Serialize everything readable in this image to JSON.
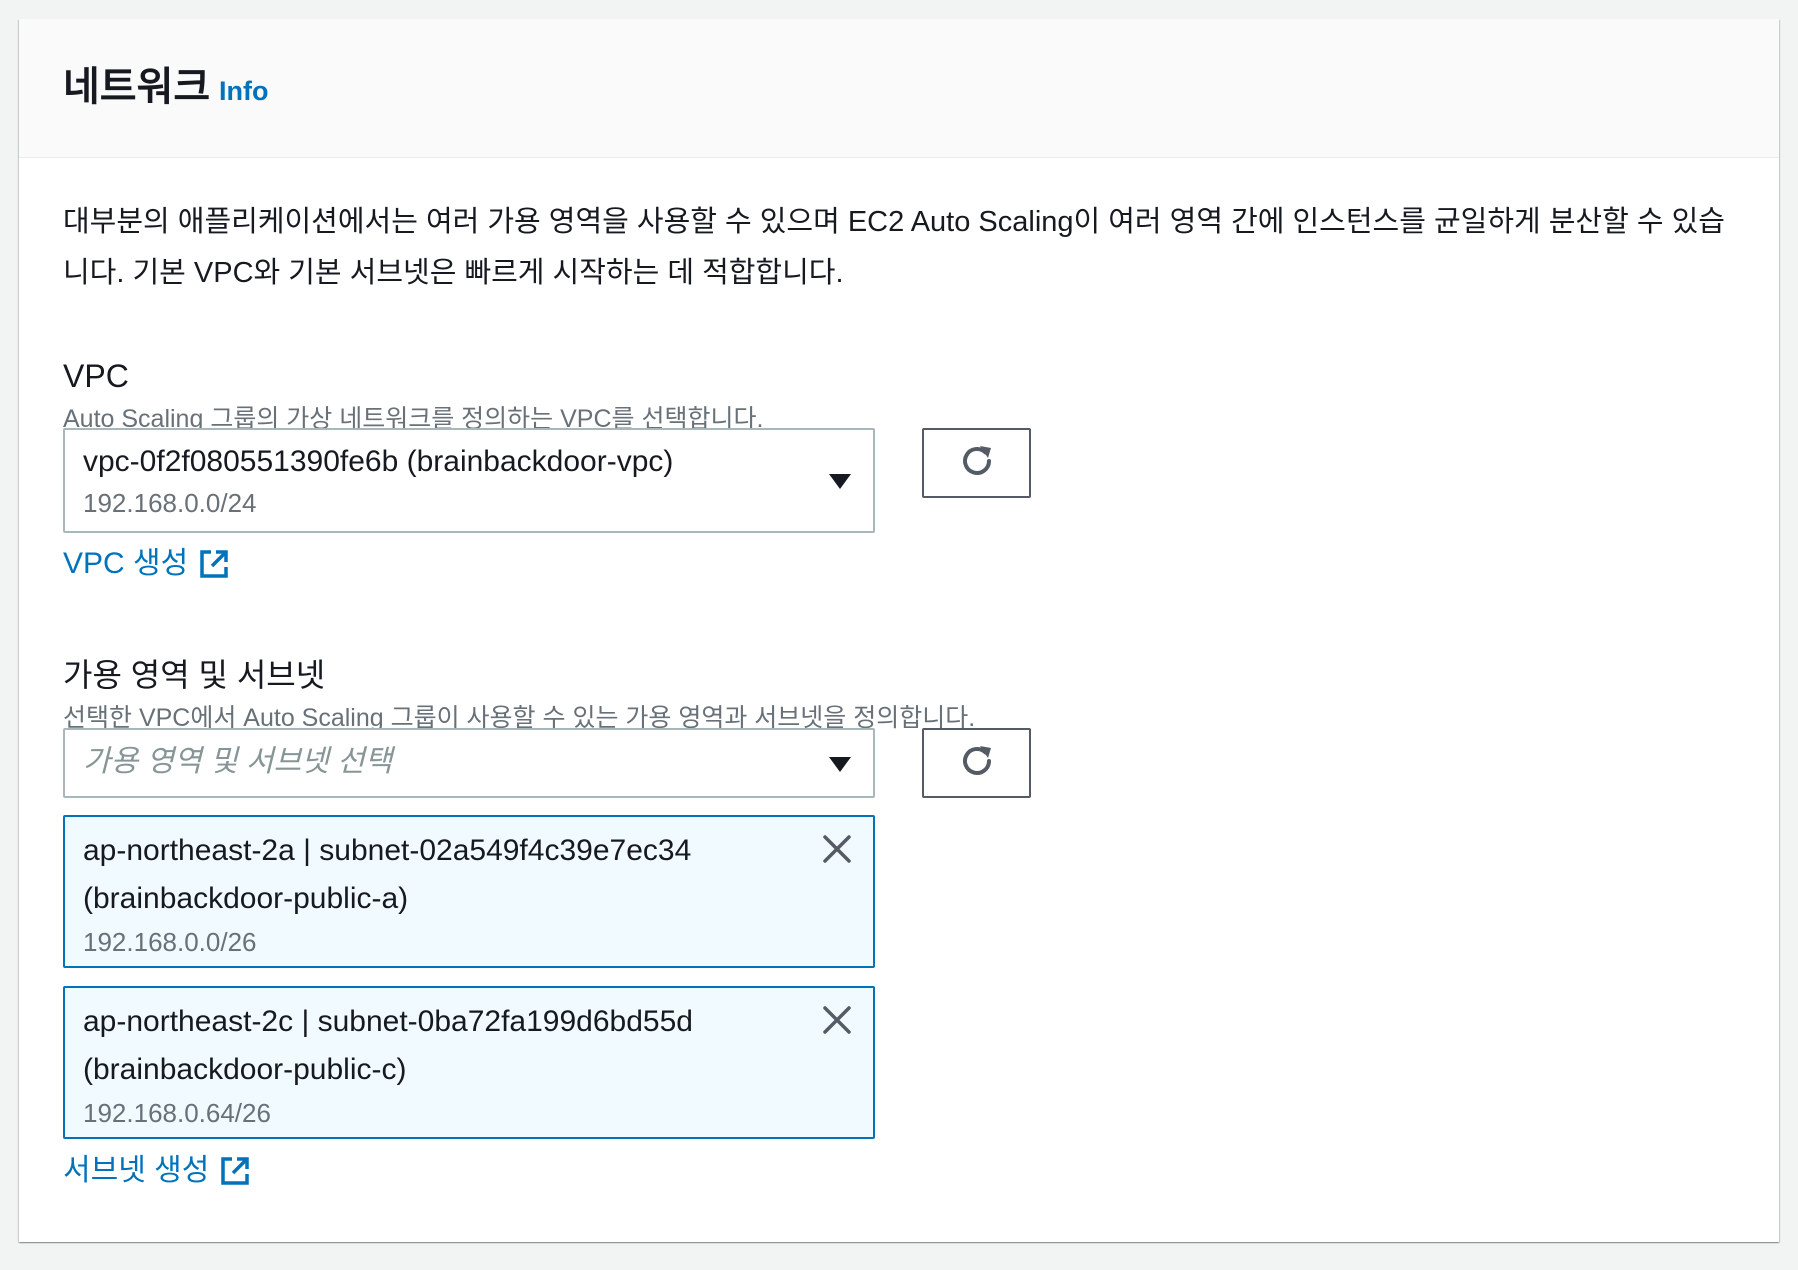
{
  "header": {
    "title": "네트워크",
    "info_label": "Info"
  },
  "description": {
    "line1": "대부분의 애플리케이션에서는 여러 가용 영역을 사용할 수 있으며 EC2 Auto Scaling이 여러 영역 간에 인스턴스를 균일하게 분산할 수 있습",
    "line2": "니다. 기본 VPC와 기본 서브넷은 빠르게 시작하는 데 적합합니다."
  },
  "vpc": {
    "label": "VPC",
    "hint": "Auto Scaling 그룹의 가상 네트워크를 정의하는 VPC를 선택합니다.",
    "selected_value": "vpc-0f2f080551390fe6b (brainbackdoor-vpc)",
    "selected_cidr": "192.168.0.0/24",
    "create_link": "VPC 생성"
  },
  "subnets": {
    "label": "가용 영역 및 서브넷",
    "hint": "선택한 VPC에서 Auto Scaling 그룹이 사용할 수 있는 가용 영역과 서브넷을 정의합니다.",
    "placeholder": "가용 영역 및 서브넷 선택",
    "tokens": [
      {
        "line1": "ap-northeast-2a | subnet-02a549f4c39e7ec34",
        "line2": "(brainbackdoor-public-a)",
        "cidr": "192.168.0.0/26"
      },
      {
        "line1": "ap-northeast-2c | subnet-0ba72fa199d6bd55d",
        "line2": "(brainbackdoor-public-c)",
        "cidr": "192.168.0.64/26"
      }
    ],
    "create_link": "서브넷 생성"
  },
  "icons": {
    "refresh": "refresh-icon",
    "caret": "caret-down-icon",
    "external": "external-link-icon",
    "close": "close-icon"
  },
  "colors": {
    "link": "#0073bb",
    "token_border": "#0073bb",
    "token_bg": "#f1faff"
  }
}
